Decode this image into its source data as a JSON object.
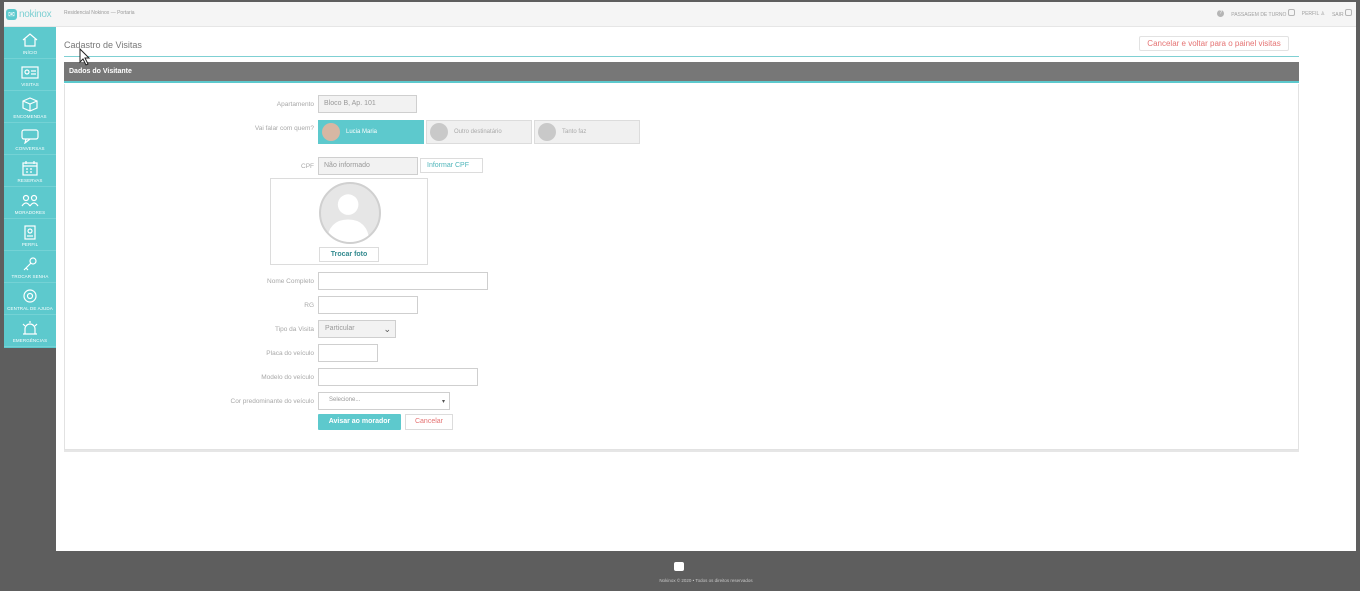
{
  "app": {
    "logo_text": "nokinox",
    "breadcrumb": "Residencial Nokinox — Portaria"
  },
  "topbar": {
    "handover_label": "PASSAGEM DE TURNO",
    "profile_label": "PERFIL",
    "logout_label": "SAIR"
  },
  "sidebar": {
    "items": [
      {
        "label": "INÍCIO",
        "icon": "home-icon"
      },
      {
        "label": "VISITAS",
        "icon": "id-card-icon"
      },
      {
        "label": "ENCOMENDAS",
        "icon": "package-icon"
      },
      {
        "label": "CONVERSAS",
        "icon": "chat-icon"
      },
      {
        "label": "RESERVAS",
        "icon": "calendar-icon"
      },
      {
        "label": "MORADORES",
        "icon": "users-icon"
      },
      {
        "label": "PERFIL",
        "icon": "badge-icon"
      },
      {
        "label": "TROCAR SENHA",
        "icon": "key-icon"
      },
      {
        "label": "CENTRAL DE AJUDA",
        "icon": "lifebuoy-icon"
      },
      {
        "label": "EMERGÊNCIAS",
        "icon": "alarm-icon"
      }
    ]
  },
  "page": {
    "title": "Cadastro de Visitas",
    "cancel_back_label": "Cancelar e voltar para o painel visitas",
    "section_title": "Dados do Visitante"
  },
  "form": {
    "apartment_label": "Apartamento",
    "apartment_value": "Bloco B, Ap. 101",
    "who_label": "Vai falar com quem?",
    "who_options": [
      "Lucia Maria",
      "Outro destinatário",
      "Tanto faz"
    ],
    "cpf_label": "CPF",
    "cpf_value": "Não informado",
    "cpf_button": "Informar CPF",
    "change_photo": "Trocar foto",
    "name_label": "Nome Completo",
    "rg_label": "RG",
    "visit_type_label": "Tipo da Visita",
    "visit_type_value": "Particular",
    "plate_label": "Placa do veículo",
    "model_label": "Modelo do veículo",
    "color_label": "Cor predominante do veículo",
    "color_placeholder": "Selecione...",
    "submit_label": "Avisar ao morador",
    "cancel_label": "Cancelar"
  },
  "footer": {
    "text": "Nokinox © 2020 • Todos os direitos reservados"
  },
  "colors": {
    "accent": "#5dc9cd",
    "danger": "#e57373",
    "header": "#777777"
  }
}
